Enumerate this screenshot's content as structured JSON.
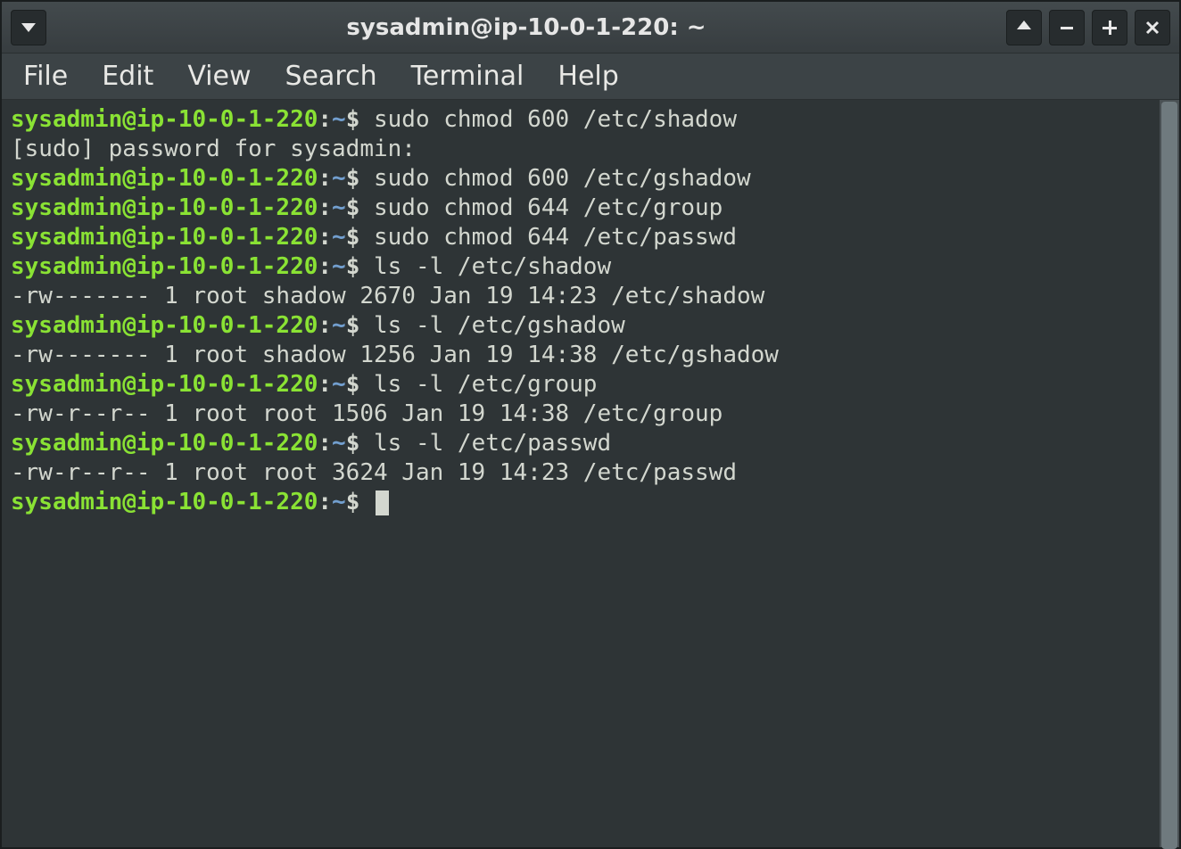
{
  "titlebar": {
    "title": "sysadmin@ip-10-0-1-220: ~"
  },
  "menubar": {
    "items": [
      "File",
      "Edit",
      "View",
      "Search",
      "Terminal",
      "Help"
    ]
  },
  "prompt": {
    "user_host": "sysadmin@ip-10-0-1-220",
    "sep": ":",
    "path": "~",
    "sigil": "$"
  },
  "lines": [
    {
      "type": "prompt",
      "cmd": "sudo chmod 600 /etc/shadow"
    },
    {
      "type": "output",
      "text": "[sudo] password for sysadmin:"
    },
    {
      "type": "prompt",
      "cmd": "sudo chmod 600 /etc/gshadow"
    },
    {
      "type": "prompt",
      "cmd": "sudo chmod 644 /etc/group"
    },
    {
      "type": "prompt",
      "cmd": "sudo chmod 644 /etc/passwd"
    },
    {
      "type": "prompt",
      "cmd": "ls -l /etc/shadow"
    },
    {
      "type": "output",
      "text": "-rw------- 1 root shadow 2670 Jan 19 14:23 /etc/shadow"
    },
    {
      "type": "prompt",
      "cmd": "ls -l /etc/gshadow"
    },
    {
      "type": "output",
      "text": "-rw------- 1 root shadow 1256 Jan 19 14:38 /etc/gshadow"
    },
    {
      "type": "prompt",
      "cmd": "ls -l /etc/group"
    },
    {
      "type": "output",
      "text": "-rw-r--r-- 1 root root 1506 Jan 19 14:38 /etc/group"
    },
    {
      "type": "prompt",
      "cmd": "ls -l /etc/passwd"
    },
    {
      "type": "output",
      "text": "-rw-r--r-- 1 root root 3624 Jan 19 14:23 /etc/passwd"
    },
    {
      "type": "prompt",
      "cmd": "",
      "cursor": true
    }
  ]
}
